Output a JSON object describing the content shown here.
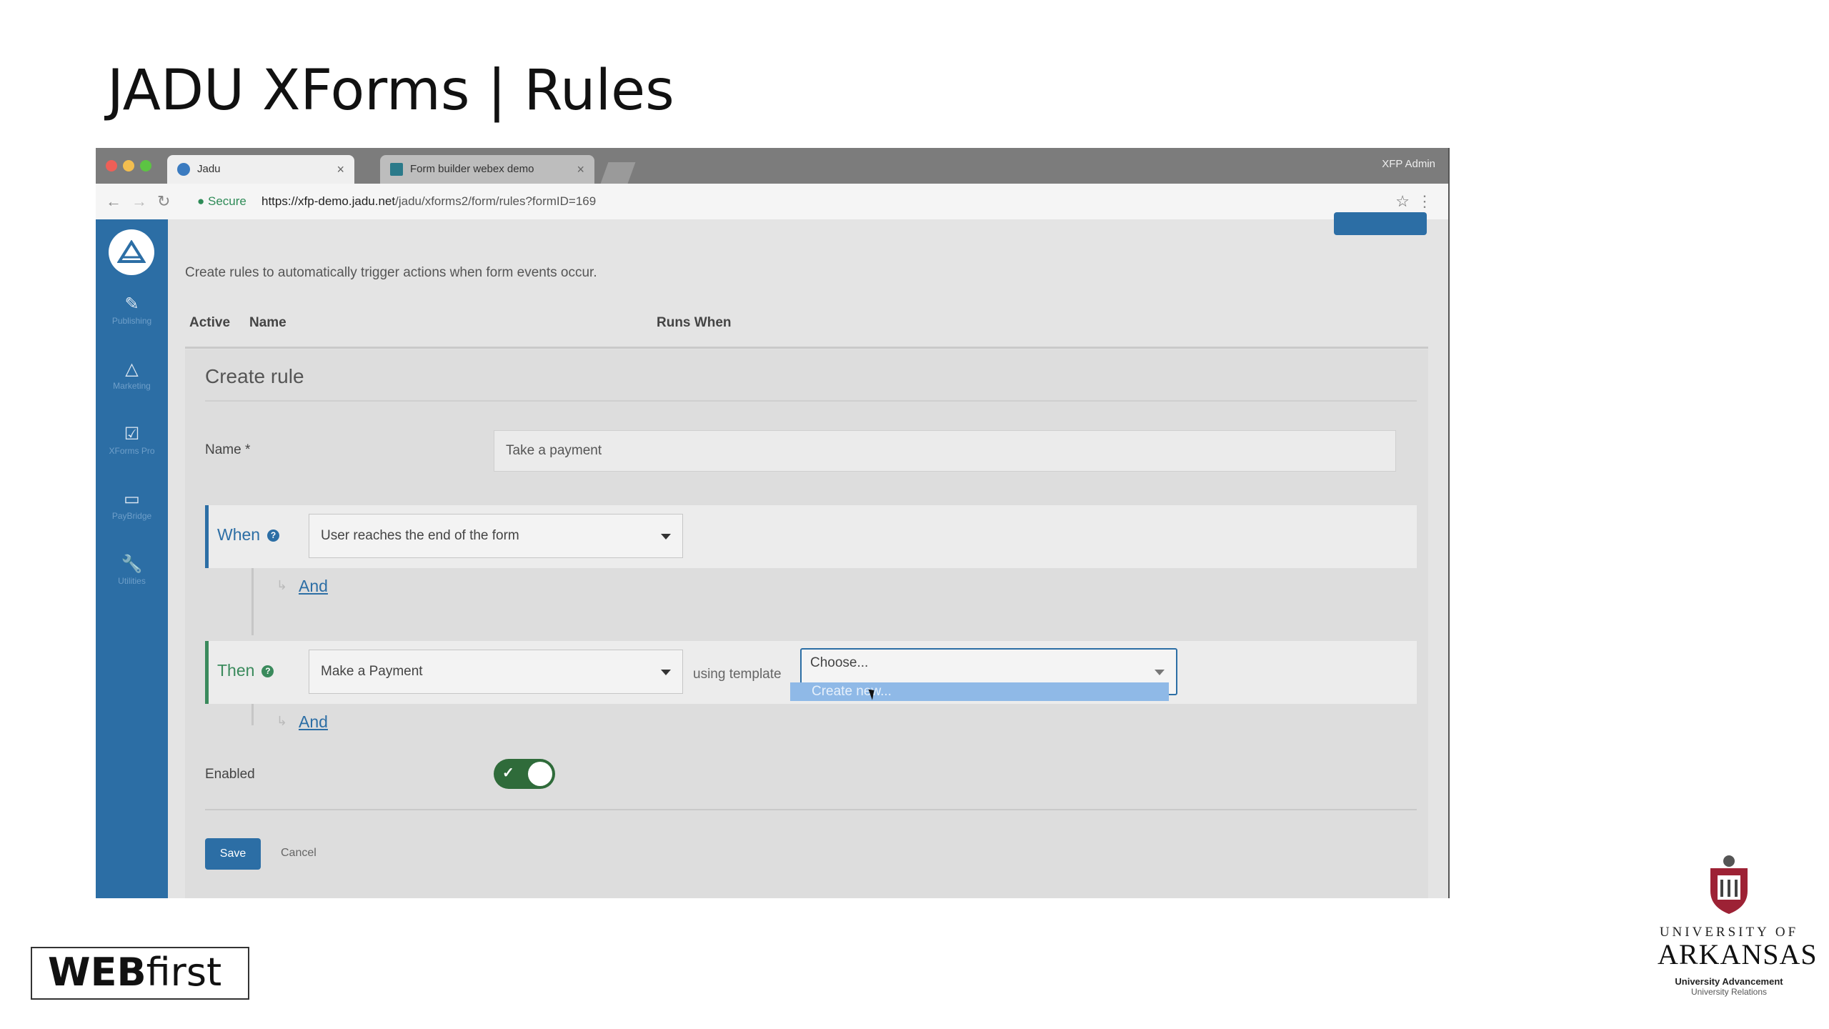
{
  "slide": {
    "title": "JADU XForms | Rules"
  },
  "browser": {
    "tabs": [
      {
        "label": "Jadu",
        "close": "×"
      },
      {
        "label": "Form builder webex demo",
        "close": "×"
      }
    ],
    "top_right": "XFP Admin",
    "address": {
      "secure_label": "Secure",
      "url_host": "https://xfp-demo.jadu.net",
      "url_path": "/jadu/xforms2/form/rules?formID=169"
    }
  },
  "sidebar": {
    "items": [
      {
        "icon": "pencil-icon",
        "label": "Publishing"
      },
      {
        "icon": "megaphone-icon",
        "label": "Marketing"
      },
      {
        "icon": "checkbox-icon",
        "label": "XForms Pro"
      },
      {
        "icon": "card-icon",
        "label": "PayBridge"
      },
      {
        "icon": "wrench-icon",
        "label": "Utilities"
      }
    ]
  },
  "main": {
    "intro": "Create rules to automatically trigger actions when form events occur.",
    "columns": [
      "Active",
      "Name",
      "Runs When"
    ],
    "create_rule": {
      "title": "Create rule",
      "name_label": "Name *",
      "name_value": "Take a payment",
      "when": {
        "label": "When",
        "help": "?",
        "selected": "User reaches the end of the form",
        "and_link": "And"
      },
      "then": {
        "label": "Then",
        "help": "?",
        "selected": "Make a Payment",
        "using_label": "using template",
        "template_selected": "Choose...",
        "dropdown_option": "Create new...",
        "and_link": "And"
      },
      "enabled_label": "Enabled",
      "enabled": true,
      "save_label": "Save",
      "cancel_label": "Cancel"
    }
  },
  "colors": {
    "sidebar": "#2c6ea5",
    "when_accent": "#2c6ea5",
    "then_accent": "#3a8a5c",
    "toggle_on": "#2f6b3a"
  },
  "brand": {
    "webfirst_bold": "WEB",
    "webfirst_light": "first",
    "uark_line1": "UNIVERSITY OF",
    "uark_line2": "ARKANSAS",
    "uark_line3": "University Advancement",
    "uark_line4": "University Relations"
  }
}
